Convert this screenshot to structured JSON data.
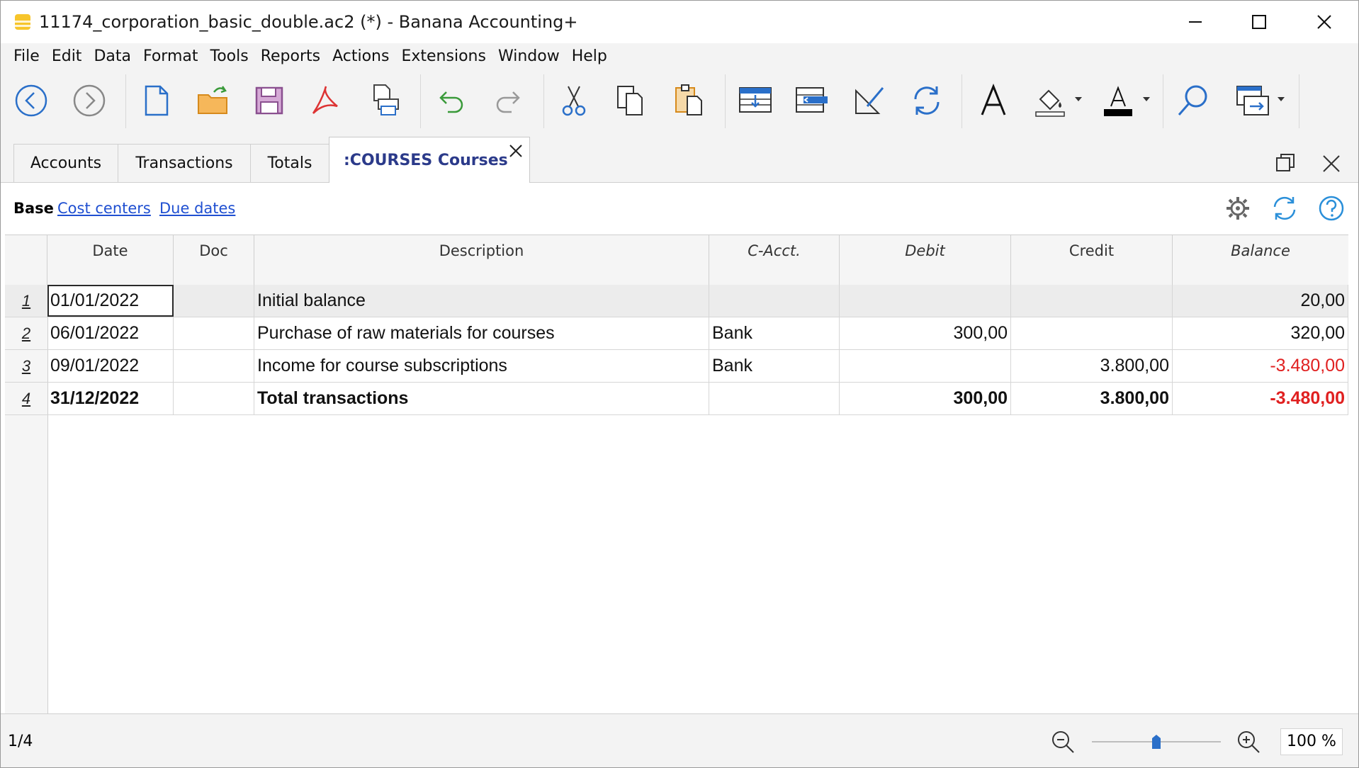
{
  "window": {
    "title": "11174_corporation_basic_double.ac2 (*) - Banana Accounting+"
  },
  "menu": [
    "File",
    "Edit",
    "Data",
    "Format",
    "Tools",
    "Reports",
    "Actions",
    "Extensions",
    "Window",
    "Help"
  ],
  "toolbar": {
    "icons": [
      "back-icon",
      "forward-icon",
      "new-file-icon",
      "open-folder-icon",
      "save-icon",
      "pdf-icon",
      "print-icon",
      "undo-icon",
      "redo-icon",
      "cut-icon",
      "copy-icon",
      "paste-icon",
      "insert-rows-icon",
      "move-rows-icon",
      "edit-format-icon",
      "recalculate-icon",
      "font-icon",
      "fill-color-icon",
      "text-color-icon",
      "find-icon",
      "window-switch-icon"
    ]
  },
  "tabs": [
    {
      "label": "Accounts"
    },
    {
      "label": "Transactions"
    },
    {
      "label": "Totals"
    },
    {
      "label": ":COURSES Courses",
      "active": true
    }
  ],
  "views": {
    "current": "Base",
    "links": [
      "Cost centers",
      "Due dates"
    ]
  },
  "table": {
    "columns": [
      "Date",
      "Doc",
      "Description",
      "C-Acct.",
      "Debit",
      "Credit",
      "Balance"
    ],
    "rows": [
      {
        "n": "1",
        "date": "01/01/2022",
        "doc": "",
        "description": "Initial balance",
        "cacct": "",
        "debit": "",
        "credit": "",
        "balance": "20,00"
      },
      {
        "n": "2",
        "date": "06/01/2022",
        "doc": "",
        "description": "Purchase of raw materials for courses",
        "cacct": "Bank",
        "debit": "300,00",
        "credit": "",
        "balance": "320,00"
      },
      {
        "n": "3",
        "date": "09/01/2022",
        "doc": "",
        "description": "Income for course subscriptions",
        "cacct": "Bank",
        "debit": "",
        "credit": "3.800,00",
        "balance": "-3.480,00"
      },
      {
        "n": "4",
        "date": "31/12/2022",
        "doc": "",
        "description": "Total transactions",
        "cacct": "",
        "debit": "300,00",
        "credit": "3.800,00",
        "balance": "-3.480,00"
      }
    ]
  },
  "status": {
    "row_count": "1/4",
    "zoom": "100 %",
    "zoom_level": 0.5
  },
  "colors": {
    "negative": "#e02020",
    "link": "#1f4fd1",
    "active_tab": "#2b3a8a"
  }
}
